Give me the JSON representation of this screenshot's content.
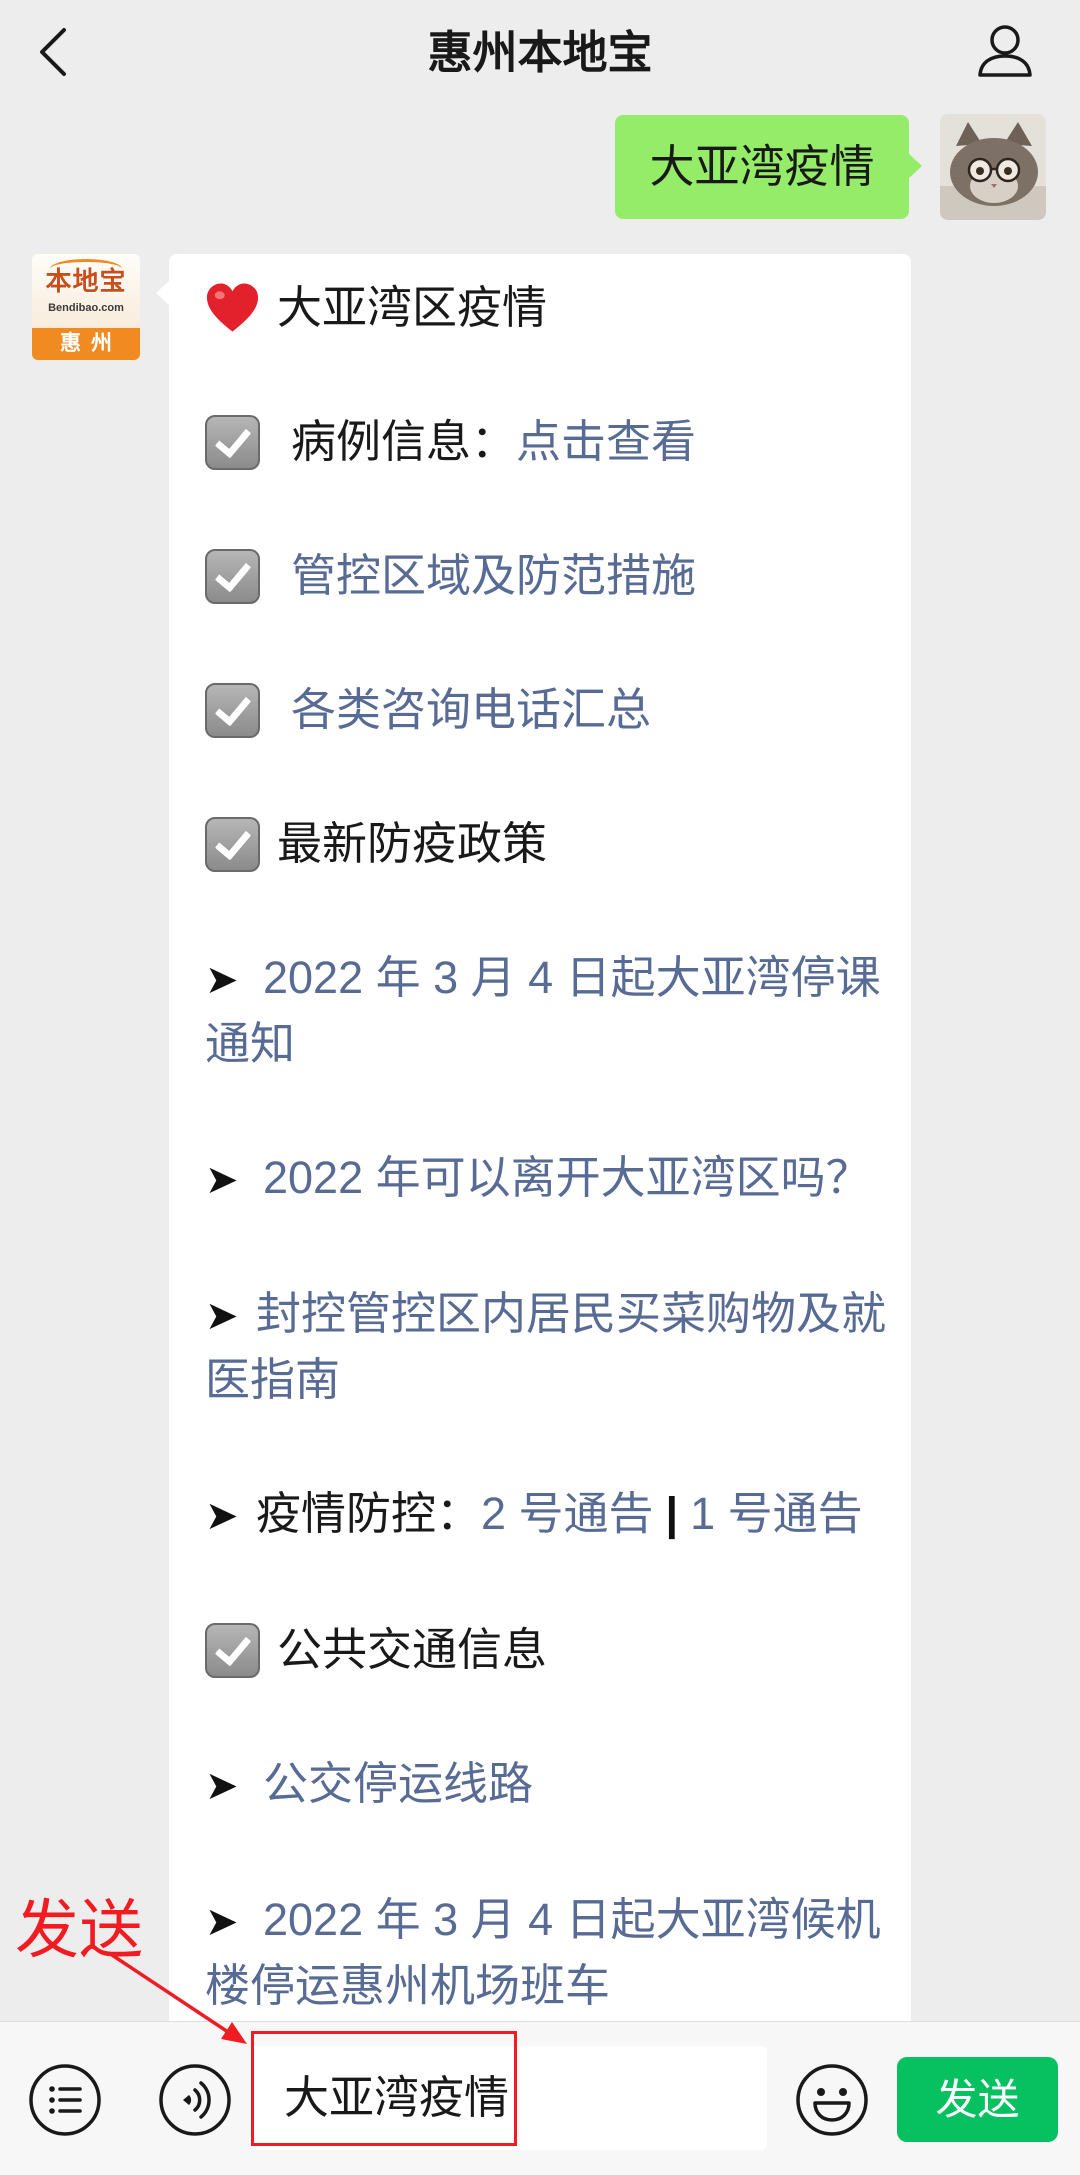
{
  "header": {
    "title": "惠州本地宝",
    "back_icon": "chevron-left-icon",
    "profile_icon": "person-icon"
  },
  "colors": {
    "background": "#ededed",
    "bubble_sent": "#95ec69",
    "link": "#576b95",
    "send_button": "#07c160",
    "annotation": "#f01c22"
  },
  "user_message": {
    "text": "大亚湾疫情",
    "avatar_icon": "cat-photo-avatar"
  },
  "bot": {
    "avatar": {
      "brand": "本地宝",
      "site": "Bendibao.com",
      "city": "惠州"
    },
    "reply": {
      "bullet": "➤",
      "rows": [
        {
          "icon": "heart-icon",
          "text": "大亚湾区疫情"
        },
        {
          "icon": "checkbox-icon",
          "label": "病例信息：",
          "link": "点击查看"
        },
        {
          "icon": "checkbox-icon",
          "link": "管控区域及防范措施"
        },
        {
          "icon": "checkbox-icon",
          "link": "各类咨询电话汇总"
        },
        {
          "icon": "checkbox-icon",
          "text": "最新防疫政策"
        },
        {
          "lines": [
            "2022 年 3 月 4 日起大亚湾停课",
            "通知"
          ]
        },
        {
          "link": "2022 年可以离开大亚湾区吗？"
        },
        {
          "lines": [
            "封控管控区内居民买菜购物及就",
            "医指南"
          ]
        },
        {
          "label": "疫情防控：",
          "links": [
            "2 号通告",
            "1 号通告"
          ],
          "separator": "|"
        },
        {
          "icon": "checkbox-icon",
          "text": "公共交通信息"
        },
        {
          "link": "公交停运线路"
        },
        {
          "lines": [
            "2022 年 3 月 4 日起大亚湾候机",
            "楼停运惠州机场班车"
          ]
        }
      ]
    }
  },
  "input_bar": {
    "list_icon": "list-menu-icon",
    "voice_icon": "voice-icon",
    "text": "大亚湾疫情",
    "emoji_icon": "emoji-icon",
    "send_label": "发送"
  },
  "annotation": {
    "label": "发送"
  }
}
